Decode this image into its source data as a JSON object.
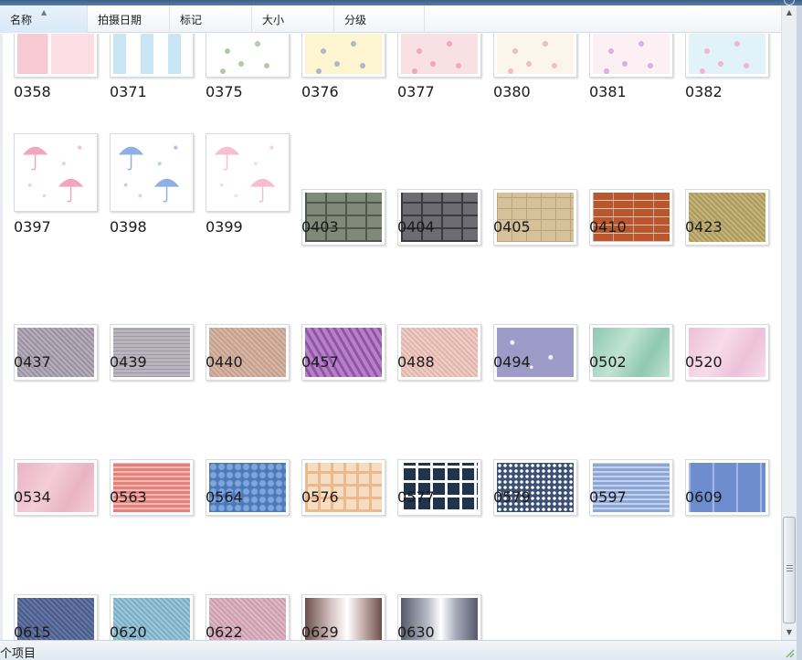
{
  "columns": [
    {
      "label": "名称",
      "sorted": true
    },
    {
      "label": "拍摄日期",
      "sorted": false
    },
    {
      "label": "标记",
      "sorted": false
    },
    {
      "label": "大小",
      "sorted": false
    },
    {
      "label": "分级",
      "sorted": false
    }
  ],
  "status": {
    "text": "个项目"
  },
  "items": [
    {
      "name": "0358",
      "pattern": "stripe-pink",
      "colors": [
        "#f7c9d3",
        "#fbdde4"
      ],
      "shape": "square"
    },
    {
      "name": "0371",
      "pattern": "stripe-blue",
      "colors": [
        "#c9e6f7",
        "#ffffff"
      ],
      "shape": "square"
    },
    {
      "name": "0375",
      "pattern": "flowers",
      "colors": [
        "#ffffff",
        "#9bbf8c"
      ],
      "shape": "square"
    },
    {
      "name": "0376",
      "pattern": "flowers",
      "colors": [
        "#fdf5cf",
        "#98a8c8"
      ],
      "shape": "square"
    },
    {
      "name": "0377",
      "pattern": "flowers",
      "colors": [
        "#f8e0e3",
        "#e59db0"
      ],
      "shape": "square"
    },
    {
      "name": "0380",
      "pattern": "flowers",
      "colors": [
        "#fbf5ea",
        "#eab3b0"
      ],
      "shape": "square"
    },
    {
      "name": "0381",
      "pattern": "flowers",
      "colors": [
        "#fdf0f4",
        "#c9a1d8"
      ],
      "shape": "square"
    },
    {
      "name": "0382",
      "pattern": "flowers",
      "colors": [
        "#e2f2f9",
        "#f3a8bf"
      ],
      "shape": "square"
    },
    {
      "name": "0397",
      "pattern": "umbrella",
      "colors": [
        "#ffffff",
        "#f2a6bd"
      ],
      "shape": "square"
    },
    {
      "name": "0398",
      "pattern": "umbrella",
      "colors": [
        "#ffffff",
        "#8fb0e3"
      ],
      "shape": "square"
    },
    {
      "name": "0399",
      "pattern": "umbrella",
      "colors": [
        "#ffffff",
        "#f6bfd0"
      ],
      "shape": "square"
    },
    {
      "name": "0403",
      "pattern": "stone",
      "colors": [
        "#7f8a78",
        "#4f5a4d"
      ],
      "shape": "wide"
    },
    {
      "name": "0404",
      "pattern": "stone",
      "colors": [
        "#6d6c72",
        "#3b3a40"
      ],
      "shape": "wide"
    },
    {
      "name": "0405",
      "pattern": "tile",
      "colors": [
        "#d5c29a",
        "#b8a47a"
      ],
      "shape": "wide"
    },
    {
      "name": "0410",
      "pattern": "brick",
      "colors": [
        "#b9562e",
        "#8a3b1e"
      ],
      "shape": "wide"
    },
    {
      "name": "0423",
      "pattern": "fine",
      "colors": [
        "#c4b478",
        "#ab9b62"
      ],
      "shape": "wide"
    },
    {
      "name": "0437",
      "pattern": "fine",
      "colors": [
        "#b6aeba",
        "#9a92a0"
      ],
      "shape": "wide"
    },
    {
      "name": "0439",
      "pattern": "grid",
      "colors": [
        "#b9b5bf",
        "#9d99a5"
      ],
      "shape": "wide"
    },
    {
      "name": "0440",
      "pattern": "fine",
      "colors": [
        "#d8b6a5",
        "#c3a08f"
      ],
      "shape": "wide"
    },
    {
      "name": "0457",
      "pattern": "weave",
      "colors": [
        "#b880c8",
        "#8f56a4"
      ],
      "shape": "wide"
    },
    {
      "name": "0488",
      "pattern": "fine",
      "colors": [
        "#efcdc5",
        "#e0b6ac"
      ],
      "shape": "wide"
    },
    {
      "name": "0494",
      "pattern": "speckle",
      "colors": [
        "#9d9bc8",
        "#f2f0fb"
      ],
      "shape": "wide"
    },
    {
      "name": "0502",
      "pattern": "marble",
      "colors": [
        "#8fc8b2",
        "#bfe2d3"
      ],
      "shape": "wide"
    },
    {
      "name": "0520",
      "pattern": "marble",
      "colors": [
        "#ecc1d9",
        "#f7dbe9"
      ],
      "shape": "wide"
    },
    {
      "name": "0534",
      "pattern": "marble",
      "colors": [
        "#e9b4c4",
        "#f3cdd8"
      ],
      "shape": "wide"
    },
    {
      "name": "0563",
      "pattern": "knit",
      "colors": [
        "#e2807a",
        "#f4b8b2"
      ],
      "shape": "wide"
    },
    {
      "name": "0564",
      "pattern": "bubble",
      "colors": [
        "#4b79b9",
        "#7fa6dc"
      ],
      "shape": "wide"
    },
    {
      "name": "0576",
      "pattern": "plaid-light",
      "colors": [
        "#f6dcc1",
        "#eab98d"
      ],
      "shape": "wide"
    },
    {
      "name": "0577",
      "pattern": "plaid-dark",
      "colors": [
        "#20344f",
        "#ffffff"
      ],
      "shape": "wide"
    },
    {
      "name": "0579",
      "pattern": "dots",
      "colors": [
        "#3c5172",
        "#ffffff"
      ],
      "shape": "wide"
    },
    {
      "name": "0597",
      "pattern": "knit",
      "colors": [
        "#8ea6d6",
        "#c3d2ef"
      ],
      "shape": "wide"
    },
    {
      "name": "0609",
      "pattern": "cable",
      "colors": [
        "#6e8dcf",
        "#9fb6e6"
      ],
      "shape": "wide"
    },
    {
      "name": "0615",
      "pattern": "fine",
      "colors": [
        "#6476a4",
        "#4b5b8a"
      ],
      "shape": "wide"
    },
    {
      "name": "0620",
      "pattern": "fine",
      "colors": [
        "#9dc7d8",
        "#7aaec4"
      ],
      "shape": "wide"
    },
    {
      "name": "0622",
      "pattern": "fine",
      "colors": [
        "#e0b7c4",
        "#cc9fae"
      ],
      "shape": "wide"
    },
    {
      "name": "0629",
      "pattern": "sheen-warm",
      "colors": [
        "#6b4f4c",
        "#ffffff"
      ],
      "shape": "wide"
    },
    {
      "name": "0630",
      "pattern": "sheen-cool",
      "colors": [
        "#55596a",
        "#ffffff"
      ],
      "shape": "wide"
    }
  ]
}
